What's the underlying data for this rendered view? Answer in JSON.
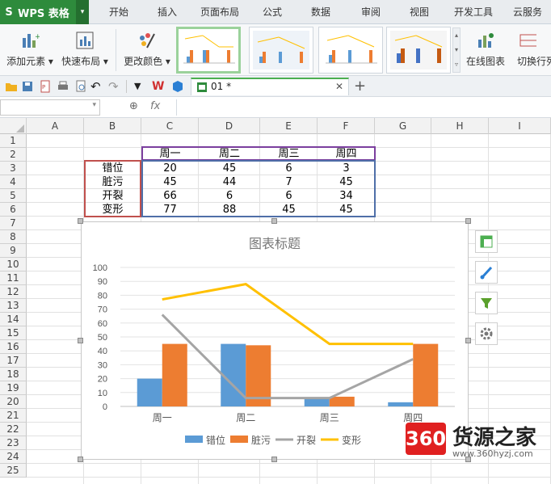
{
  "app": {
    "name": "WPS 表格"
  },
  "menu": [
    "开始",
    "插入",
    "页面布局",
    "公式",
    "数据",
    "审阅",
    "视图",
    "开发工具",
    "云服务"
  ],
  "ribbon": {
    "add_element": "添加元素",
    "quick_layout": "快速布局",
    "change_color": "更改颜色",
    "online_chart": "在线图表",
    "switch_rowcol": "切换行列"
  },
  "document": {
    "tab_title": "01 *"
  },
  "formula_bar": {
    "fx": "fx"
  },
  "columns": [
    "A",
    "B",
    "C",
    "D",
    "E",
    "F",
    "G",
    "H",
    "I"
  ],
  "rows": [
    "1",
    "2",
    "3",
    "4",
    "5",
    "6",
    "7",
    "8",
    "9",
    "10",
    "11",
    "12",
    "13",
    "14",
    "15",
    "16",
    "17",
    "18",
    "19",
    "20",
    "21",
    "22",
    "23",
    "24",
    "25"
  ],
  "table": {
    "header": [
      "周一",
      "周二",
      "周三",
      "周四"
    ],
    "rows": [
      {
        "label": "错位",
        "values": [
          "20",
          "45",
          "6",
          "3"
        ]
      },
      {
        "label": "脏污",
        "values": [
          "45",
          "44",
          "7",
          "45"
        ]
      },
      {
        "label": "开裂",
        "values": [
          "66",
          "6",
          "6",
          "34"
        ]
      },
      {
        "label": "变形",
        "values": [
          "77",
          "88",
          "45",
          "45"
        ]
      }
    ]
  },
  "chart_data": {
    "type": "bar",
    "title": "图表标题",
    "categories": [
      "周一",
      "周二",
      "周三",
      "周四"
    ],
    "ylim": [
      0,
      100
    ],
    "yticks": [
      "0",
      "10",
      "20",
      "30",
      "40",
      "50",
      "60",
      "70",
      "80",
      "90",
      "100"
    ],
    "grid": true,
    "legend_position": "bottom",
    "series": [
      {
        "name": "错位",
        "type": "bar",
        "color": "#5b9bd5",
        "values": [
          20,
          45,
          6,
          3
        ]
      },
      {
        "name": "脏污",
        "type": "bar",
        "color": "#ed7d31",
        "values": [
          45,
          44,
          7,
          45
        ]
      },
      {
        "name": "开裂",
        "type": "line",
        "color": "#a5a5a5",
        "values": [
          66,
          6,
          6,
          34
        ]
      },
      {
        "name": "变形",
        "type": "line",
        "color": "#ffc000",
        "values": [
          77,
          88,
          45,
          45
        ]
      }
    ]
  },
  "watermark": {
    "brand": "360",
    "name": "货源之家",
    "url": "www.360hyzj.com"
  },
  "colors": {
    "accent_green": "#2e8b3c",
    "header_purple": "#7b3f9e",
    "label_red": "#c0504d",
    "value_blue": "#4f6fa8"
  }
}
